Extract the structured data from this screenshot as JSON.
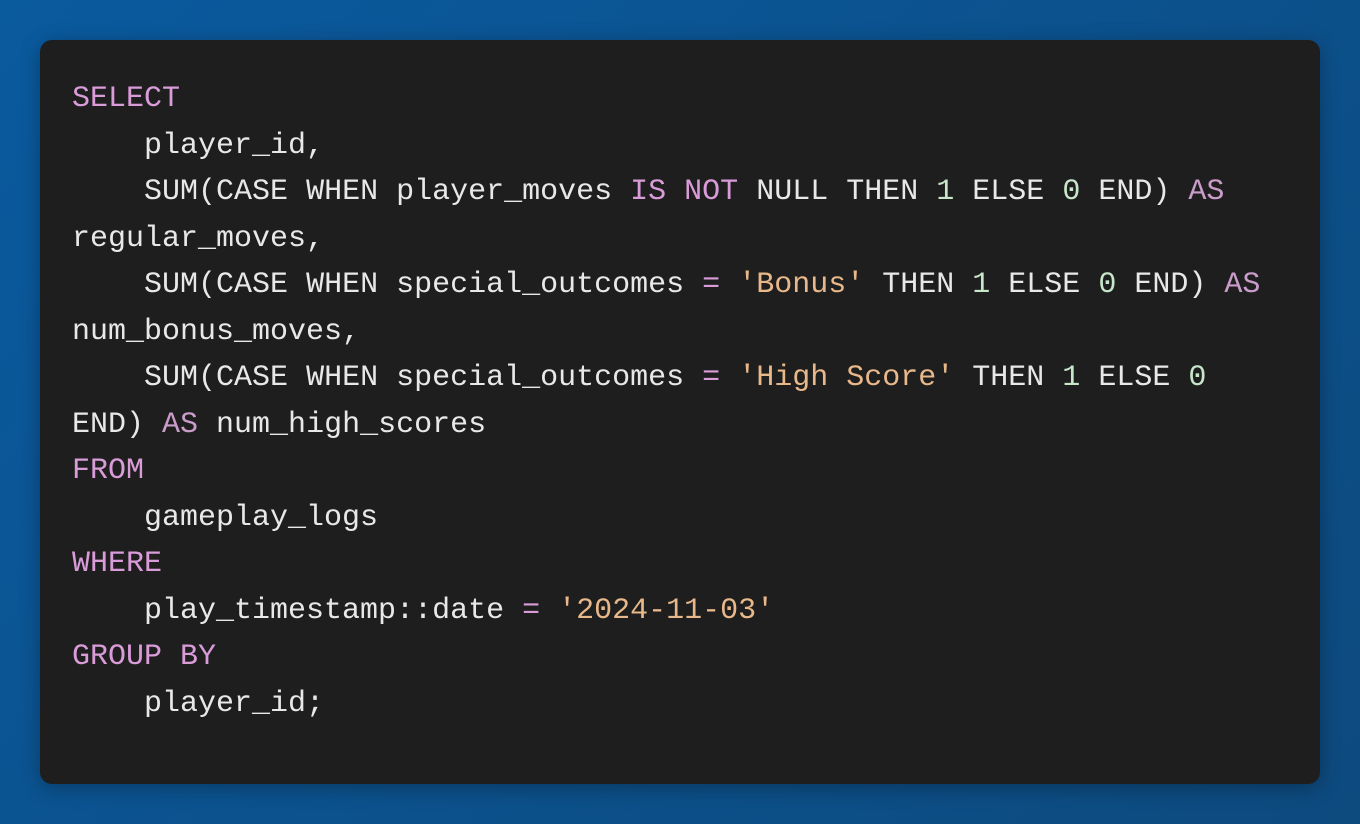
{
  "code": {
    "tokens": [
      {
        "text": "SELECT",
        "class": "kw"
      },
      {
        "text": "\n    player_id,\n    ",
        "class": "id"
      },
      {
        "text": "SUM",
        "class": "id"
      },
      {
        "text": "(",
        "class": "id"
      },
      {
        "text": "CASE",
        "class": "id"
      },
      {
        "text": " ",
        "class": "id"
      },
      {
        "text": "WHEN",
        "class": "id"
      },
      {
        "text": " player_moves ",
        "class": "id"
      },
      {
        "text": "IS",
        "class": "kw"
      },
      {
        "text": " ",
        "class": "id"
      },
      {
        "text": "NOT",
        "class": "kw"
      },
      {
        "text": " ",
        "class": "id"
      },
      {
        "text": "NULL",
        "class": "id"
      },
      {
        "text": " ",
        "class": "id"
      },
      {
        "text": "THEN",
        "class": "id"
      },
      {
        "text": " ",
        "class": "id"
      },
      {
        "text": "1",
        "class": "num"
      },
      {
        "text": " ",
        "class": "id"
      },
      {
        "text": "ELSE",
        "class": "id"
      },
      {
        "text": " ",
        "class": "id"
      },
      {
        "text": "0",
        "class": "num"
      },
      {
        "text": " ",
        "class": "id"
      },
      {
        "text": "END",
        "class": "id"
      },
      {
        "text": ") ",
        "class": "id"
      },
      {
        "text": "AS",
        "class": "kw2"
      },
      {
        "text": " regular_moves,\n    ",
        "class": "id"
      },
      {
        "text": "SUM",
        "class": "id"
      },
      {
        "text": "(",
        "class": "id"
      },
      {
        "text": "CASE",
        "class": "id"
      },
      {
        "text": " ",
        "class": "id"
      },
      {
        "text": "WHEN",
        "class": "id"
      },
      {
        "text": " special_outcomes ",
        "class": "id"
      },
      {
        "text": "=",
        "class": "op"
      },
      {
        "text": " ",
        "class": "id"
      },
      {
        "text": "'Bonus'",
        "class": "str"
      },
      {
        "text": " ",
        "class": "id"
      },
      {
        "text": "THEN",
        "class": "id"
      },
      {
        "text": " ",
        "class": "id"
      },
      {
        "text": "1",
        "class": "num"
      },
      {
        "text": " ",
        "class": "id"
      },
      {
        "text": "ELSE",
        "class": "id"
      },
      {
        "text": " ",
        "class": "id"
      },
      {
        "text": "0",
        "class": "num"
      },
      {
        "text": " ",
        "class": "id"
      },
      {
        "text": "END",
        "class": "id"
      },
      {
        "text": ") ",
        "class": "id"
      },
      {
        "text": "AS",
        "class": "kw2"
      },
      {
        "text": " num_bonus_moves,\n    ",
        "class": "id"
      },
      {
        "text": "SUM",
        "class": "id"
      },
      {
        "text": "(",
        "class": "id"
      },
      {
        "text": "CASE",
        "class": "id"
      },
      {
        "text": " ",
        "class": "id"
      },
      {
        "text": "WHEN",
        "class": "id"
      },
      {
        "text": " special_outcomes ",
        "class": "id"
      },
      {
        "text": "=",
        "class": "op"
      },
      {
        "text": " ",
        "class": "id"
      },
      {
        "text": "'High Score'",
        "class": "str"
      },
      {
        "text": " ",
        "class": "id"
      },
      {
        "text": "THEN",
        "class": "id"
      },
      {
        "text": " ",
        "class": "id"
      },
      {
        "text": "1",
        "class": "num"
      },
      {
        "text": " ",
        "class": "id"
      },
      {
        "text": "ELSE",
        "class": "id"
      },
      {
        "text": " ",
        "class": "id"
      },
      {
        "text": "0",
        "class": "num"
      },
      {
        "text": " ",
        "class": "id"
      },
      {
        "text": "END",
        "class": "id"
      },
      {
        "text": ") ",
        "class": "id"
      },
      {
        "text": "AS",
        "class": "kw2"
      },
      {
        "text": " num_high_scores\n",
        "class": "id"
      },
      {
        "text": "FROM",
        "class": "kw"
      },
      {
        "text": "\n    gameplay_logs\n",
        "class": "id"
      },
      {
        "text": "WHERE",
        "class": "kw"
      },
      {
        "text": "\n    play_timestamp::date ",
        "class": "id"
      },
      {
        "text": "=",
        "class": "op"
      },
      {
        "text": " ",
        "class": "id"
      },
      {
        "text": "'2024-11-03'",
        "class": "str"
      },
      {
        "text": "\n",
        "class": "id"
      },
      {
        "text": "GROUP BY",
        "class": "kw"
      },
      {
        "text": "\n    player_id;",
        "class": "id"
      }
    ]
  }
}
